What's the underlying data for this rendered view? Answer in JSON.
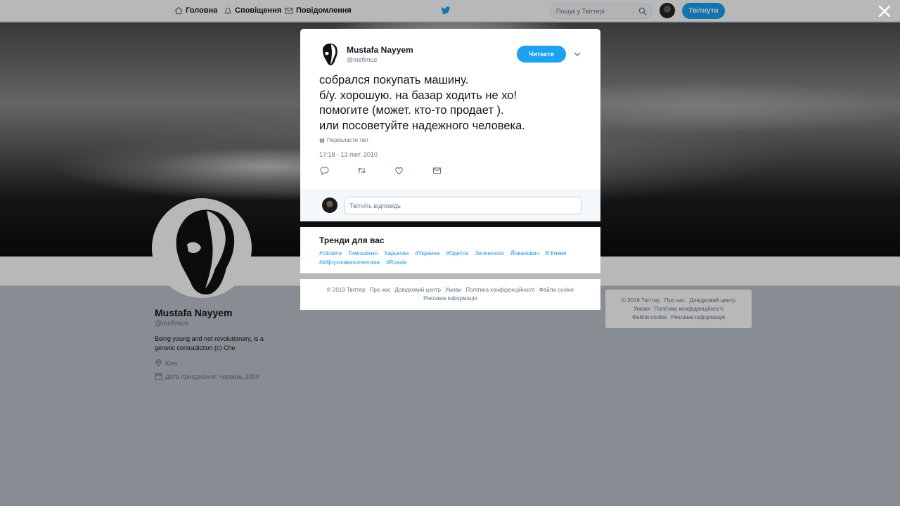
{
  "nav": {
    "items": [
      {
        "label": "Головна",
        "icon": "home-icon"
      },
      {
        "label": "Сповіщення",
        "icon": "bell-icon"
      },
      {
        "label": "Повідомлення",
        "icon": "envelope-icon"
      }
    ],
    "search_placeholder": "Пошук у Твіттері",
    "tweet_button": "Твітнути"
  },
  "profile": {
    "name": "Mustafa Nayyem",
    "handle": "@mefimus",
    "bio": "Being young and not revolutionary, is a genetic contradiction (c) Che",
    "location": "Kiev",
    "joined": "Дата приєднання: червень 2009"
  },
  "side_footer": {
    "links": [
      "© 2019 Твіттер",
      "Про нас",
      "Довідковий центр",
      "Умови",
      "Політика конфіденційності",
      "Файли cookie",
      "Реклама інформація"
    ]
  },
  "tweet": {
    "author_name": "Mustafa Nayyem",
    "author_handle": "@mefimus",
    "follow_label": "Читаєте",
    "lines": [
      "собрался покупать машину.",
      "б/у. хорошую. на базар ходить не хо!",
      "помогите (может. кто-то продает ).",
      "или посоветуйте надежного человека."
    ],
    "translate_label": "Перекласти твіт",
    "timestamp": "17:18 - 13 лют. 2010",
    "reply_placeholder": "Твітніть відповідь"
  },
  "trends": {
    "title": "Тренди для вас",
    "items": [
      "#Ukraine",
      "Тимошенко",
      "Харькова",
      "#Украина",
      "#Одесса",
      "Зеленского",
      "Йованович",
      "В Киеве",
      "#killjoysmakesomenoise",
      "#Russia"
    ]
  },
  "footer": {
    "links": [
      "© 2019 Твіттер",
      "Про нас",
      "Довідковий центр",
      "Умови",
      "Політика конфіденційності",
      "Файли cookie",
      "Реклама інформація"
    ]
  },
  "colors": {
    "accent": "#1da1f2",
    "link": "#1b95e0",
    "muted": "#657786",
    "text": "#14171a"
  }
}
